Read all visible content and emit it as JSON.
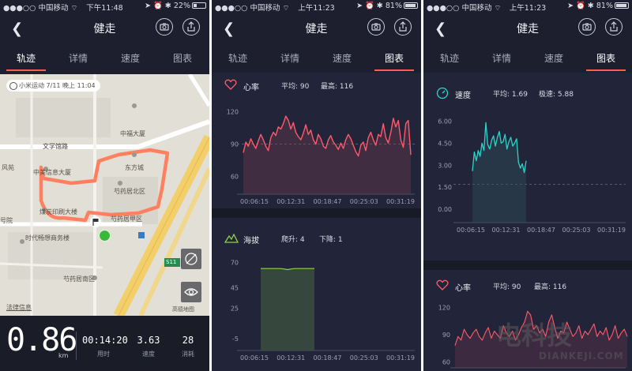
{
  "screens": [
    {
      "status": {
        "carrier": "●●●○○ 中国移动 ⌔",
        "time": "下午11:48",
        "right": "➤ ⏰ ✱ 22%",
        "battery_level": 0.22
      },
      "nav": {
        "title": "健走"
      },
      "tabs": [
        "轨迹",
        "详情",
        "速度",
        "图表"
      ],
      "active_tab": 0,
      "map": {
        "chip": "小米运动 7/11 晚上 11:04",
        "labels": {
          "zhongfu": "中福大厦",
          "wenxue": "文学馆路",
          "fengyuan": "风苑",
          "zhongmei": "中美信息大厦",
          "dongfang": "东方城",
          "shaoyao": "芍药居北区",
          "meitan": "煤炭印刷大楼",
          "anshan": "芍药居甲区",
          "haoyuan": "号院",
          "shidai": "时代畅想商务楼",
          "nanqu": "芍药居南区",
          "road": "S11",
          "legal": "法律信息",
          "gaode": "高德地图"
        }
      },
      "summary": {
        "distance": "0.86",
        "distance_unit": "km",
        "duration": "00:14:20",
        "duration_label": "用时",
        "speed": "3.63",
        "speed_label": "速度",
        "calories": "28",
        "calories_label": "消耗"
      }
    },
    {
      "status": {
        "carrier": "●●●○○ 中国移动 ⌔",
        "time": "上午11:23",
        "right": "➤ ⏰ ✱ 81%",
        "battery_level": 0.81
      },
      "nav": {
        "title": "健走"
      },
      "tabs": [
        "轨迹",
        "详情",
        "速度",
        "图表"
      ],
      "active_tab": 3,
      "heart": {
        "label": "心率",
        "avg": "平均: 90",
        "max": "最高: 116"
      },
      "altitude": {
        "label": "海拔",
        "up": "爬升: 4",
        "down": "下降: 1"
      }
    },
    {
      "status": {
        "carrier": "●●●○○ 中国移动 ⌔",
        "time": "上午11:23",
        "right": "➤ ⏰ ✱ 81%",
        "battery_level": 0.81
      },
      "nav": {
        "title": "健走"
      },
      "tabs": [
        "轨迹",
        "详情",
        "速度",
        "图表"
      ],
      "active_tab": 3,
      "speed": {
        "label": "速度",
        "avg": "平均: 1.69",
        "max": "极速: 5.88"
      },
      "heart": {
        "label": "心率",
        "avg": "平均: 90",
        "max": "最高: 116"
      }
    }
  ],
  "watermark": {
    "cn": "电科技",
    "en": "DIANKEJI.COM"
  },
  "colors": {
    "accent": "#ff5c55",
    "heart": "#ff5a6a",
    "altitude": "#8bd14a",
    "speed": "#2bd4c8",
    "route": "#ff7a5a",
    "bg": "#1d1f2e"
  },
  "chart_data": [
    {
      "type": "line",
      "title": "心率",
      "x_ticks": [
        "00:06:15",
        "00:12:31",
        "00:18:47",
        "00:25:03",
        "00:31:19"
      ],
      "y_ticks": [
        120,
        90,
        60
      ],
      "ylim": [
        45,
        130
      ],
      "reference_line": 90,
      "series": [
        {
          "values": [
            82,
            92,
            88,
            95,
            90,
            86,
            93,
            99,
            94,
            88,
            84,
            96,
            101,
            98,
            106,
            104,
            109,
            116,
            112,
            104,
            110,
            101,
            97,
            94,
            100,
            108,
            99,
            103,
            94,
            90,
            99,
            95,
            88,
            86,
            94,
            98,
            92,
            89,
            85,
            91,
            86,
            94,
            99,
            95,
            89,
            83,
            79,
            89,
            92,
            84,
            96,
            101,
            94,
            89,
            99,
            97,
            109,
            96,
            91,
            101,
            114,
            106,
            112,
            94,
            87,
            109,
            112,
            80
          ]
        }
      ]
    },
    {
      "type": "area",
      "title": "海拔",
      "x_ticks": [
        "00:06:15",
        "00:12:31",
        "00:18:47",
        "00:25:03",
        "00:31:19"
      ],
      "y_ticks": [
        70,
        45,
        25,
        -5
      ],
      "ylim": [
        -15,
        75
      ],
      "series": [
        {
          "values": [
            64,
            64,
            64,
            64,
            63,
            64,
            64,
            64,
            64
          ]
        }
      ]
    },
    {
      "type": "line",
      "title": "速度",
      "x_ticks": [
        "00:06:15",
        "00:12:31",
        "00:18:47",
        "00:25:03",
        "00:31:19"
      ],
      "y_ticks": [
        "6.00",
        "4.50",
        "3.00",
        "1.50",
        "0.00"
      ],
      "ylim": [
        -0.8,
        6.4
      ],
      "reference_line": 1.69,
      "series": [
        {
          "values": [
            2.6,
            3.9,
            3.3,
            4.0,
            3.6,
            4.5,
            4.0,
            5.9,
            4.4,
            4.1,
            4.7,
            5.0,
            4.3,
            4.9,
            5.3,
            4.5,
            4.6,
            5.1,
            4.1,
            4.6,
            4.9,
            4.3,
            4.5,
            4.8,
            3.2,
            2.8,
            3.1,
            2.5,
            3.3
          ]
        }
      ]
    },
    {
      "type": "line",
      "title": "心率",
      "y_ticks": [
        120,
        90,
        60
      ],
      "ylim": [
        55,
        125
      ],
      "series": [
        {
          "values": [
            78,
            88,
            84,
            96,
            90,
            86,
            92,
            96,
            88,
            84,
            92,
            98,
            86,
            94,
            90,
            86,
            100,
            92,
            88,
            94,
            84,
            90,
            98,
            104,
            116,
            112,
            96,
            100,
            92,
            96,
            88,
            104,
            112,
            98,
            86,
            94,
            92,
            104,
            96,
            88,
            92,
            100,
            86,
            94,
            90,
            96,
            102,
            88,
            94,
            90,
            98,
            84,
            90,
            100,
            86,
            92,
            96,
            88
          ]
        }
      ]
    }
  ]
}
